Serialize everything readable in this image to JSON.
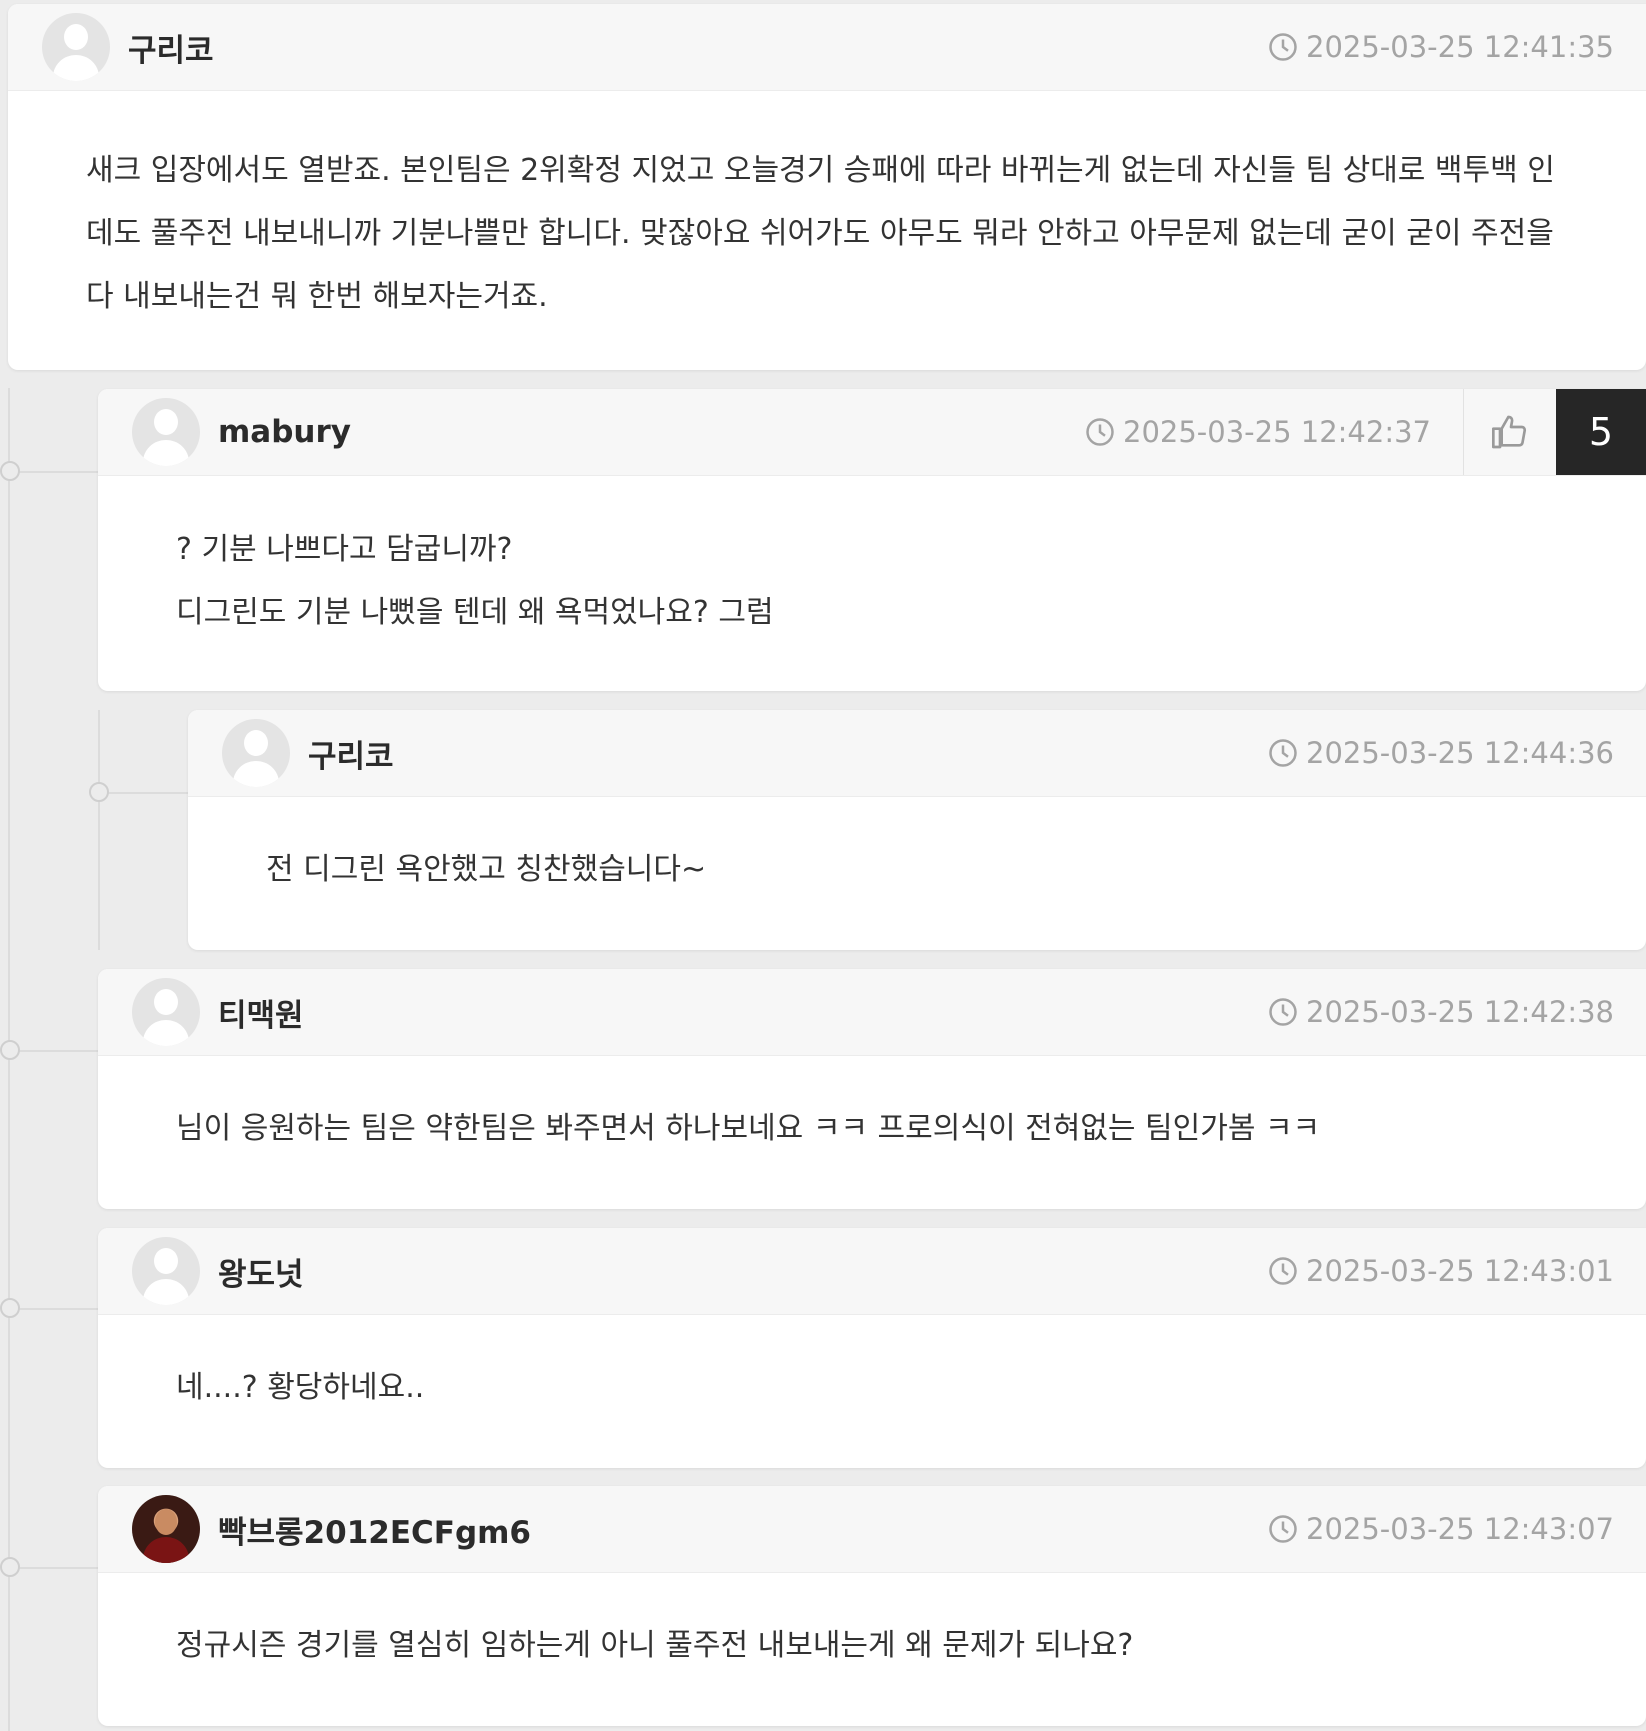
{
  "comments": [
    {
      "author": "구리코",
      "time": "2025-03-25 12:41:35",
      "avatar": "default-avatar",
      "lines": [
        "새크 입장에서도 열받죠. 본인팀은 2위확정 지었고 오늘경기 승패에 따라 바뀌는게 없는데 자신들 팀 상대로 백투백 인데도 풀주전 내보내니까 기분나쁠만 합니다. 맞잖아요 쉬어가도 아무도 뭐라 안하고 아무문제 없는데 굳이 굳이 주전을 다 내보내는건 뭐 한번 해보자는거죠."
      ]
    },
    {
      "author": "mabury",
      "time": "2025-03-25 12:42:37",
      "avatar": "default-avatar",
      "likes": "5",
      "lines": [
        "? 기분 나쁘다고 담굽니까?",
        "디그린도 기분 나뻤을 텐데 왜 욕먹었나요? 그럼"
      ]
    },
    {
      "author": "구리코",
      "time": "2025-03-25 12:44:36",
      "avatar": "default-avatar",
      "lines": [
        "전 디그린 욕안했고 칭찬했습니다~"
      ]
    },
    {
      "author": "티맥원",
      "time": "2025-03-25 12:42:38",
      "avatar": "default-avatar",
      "lines": [
        "님이 응원하는 팀은 약한팀은 봐주면서 하나보네요 ㅋㅋ 프로의식이 전혀없는 팀인가봄 ㅋㅋ"
      ]
    },
    {
      "author": "왕도넛",
      "time": "2025-03-25 12:43:01",
      "avatar": "default-avatar",
      "lines": [
        "네....? 황당하네요.."
      ]
    },
    {
      "author": "빡브롱2012ECFgm6",
      "time": "2025-03-25 12:43:07",
      "avatar": "photo-avatar",
      "lines": [
        "정규시즌 경기를 열심히 임하는게 아니 풀주전 내보내는게 왜 문제가 되나요?"
      ]
    }
  ],
  "colors": {
    "background": "#ececec",
    "header": "#f7f7f7",
    "like_count_bg": "#262626",
    "time_text": "#a4a4a4"
  },
  "icons": [
    "clock-icon",
    "thumbs-up-icon",
    "default-avatar-icon"
  ]
}
